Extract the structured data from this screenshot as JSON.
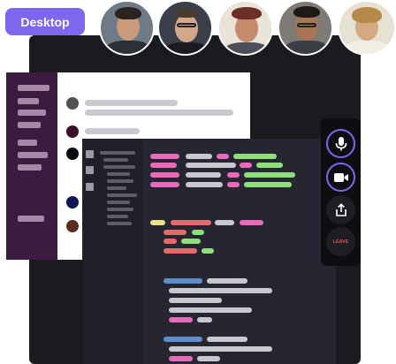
{
  "badge": {
    "label": "Desktop",
    "color": "#7b68ee"
  },
  "participants": [
    {
      "icon": "participant-1-avatar"
    },
    {
      "icon": "participant-2-avatar"
    },
    {
      "icon": "participant-3-avatar"
    },
    {
      "icon": "participant-4-avatar"
    },
    {
      "icon": "participant-5-avatar"
    }
  ],
  "controls": {
    "microphone": {
      "icon": "microphone-icon"
    },
    "camera": {
      "icon": "video-camera-icon"
    },
    "share": {
      "icon": "share-screen-icon"
    },
    "leave": {
      "label": "LEAVE",
      "color": "#e05a5a"
    }
  },
  "colors": {
    "accent": "#7b68ee",
    "chat_sidebar": "#3b1c40",
    "editor_bg": "#252631",
    "syntax_pink": "#e86ab9",
    "syntax_green": "#8fe07a",
    "syntax_red": "#e36a6a",
    "syntax_yellow": "#e9e08c",
    "syntax_blue": "#5f8fc9",
    "syntax_gray": "#c8c8cf"
  }
}
